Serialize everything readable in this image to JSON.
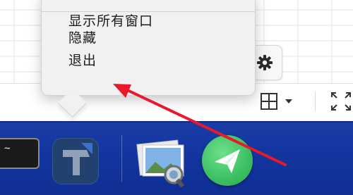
{
  "context_menu": {
    "items": [
      {
        "label": "显示所有窗口"
      },
      {
        "label": "隐藏"
      },
      {
        "label": "退出"
      }
    ]
  },
  "toolbar": {
    "gear_icon": "gear-icon",
    "table_icon": "table-grid-icon",
    "fullscreen_icon": "fullscreen-icon"
  },
  "dock": {
    "apps": [
      {
        "icon": "terminal-icon",
        "text": "~"
      },
      {
        "icon": "typora-icon"
      },
      {
        "icon": "preview-icon"
      },
      {
        "icon": "send-arrow-icon"
      }
    ]
  },
  "colors": {
    "dock": "#1336a0",
    "annotation_arrow": "#e8192c",
    "menu_bg": "#f1f1f1",
    "send_green": "#3bbf62"
  }
}
